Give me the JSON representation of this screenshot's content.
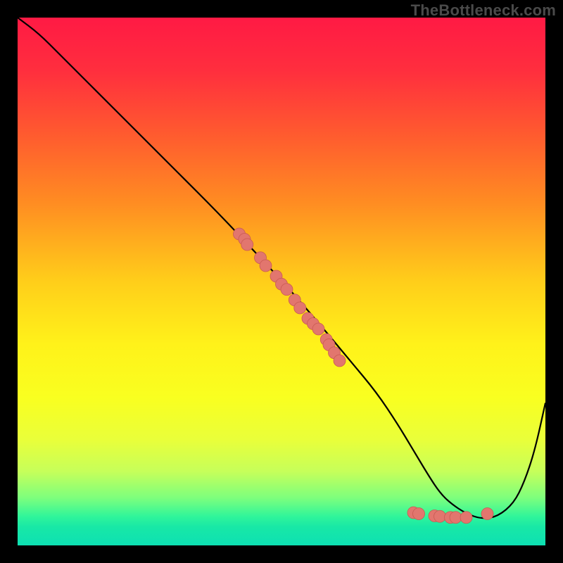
{
  "watermark": "TheBottleneck.com",
  "colors": {
    "background": "#000000",
    "curve_stroke": "#000000",
    "dot_fill": "#e2766e",
    "dot_stroke": "#c95a52",
    "gradient_stops": [
      {
        "offset": 0.0,
        "color": "#ff1a44"
      },
      {
        "offset": 0.1,
        "color": "#ff2e3e"
      },
      {
        "offset": 0.22,
        "color": "#ff5a2f"
      },
      {
        "offset": 0.35,
        "color": "#ff8c22"
      },
      {
        "offset": 0.5,
        "color": "#ffce1a"
      },
      {
        "offset": 0.62,
        "color": "#fff21a"
      },
      {
        "offset": 0.72,
        "color": "#f9ff20"
      },
      {
        "offset": 0.8,
        "color": "#e9ff3a"
      },
      {
        "offset": 0.86,
        "color": "#c6ff5a"
      },
      {
        "offset": 0.91,
        "color": "#7dff7d"
      },
      {
        "offset": 0.945,
        "color": "#30f59a"
      },
      {
        "offset": 0.965,
        "color": "#18e8a6"
      },
      {
        "offset": 1.0,
        "color": "#0de0b3"
      }
    ]
  },
  "chart_data": {
    "type": "line",
    "title": "",
    "xlabel": "",
    "ylabel": "",
    "xlim": [
      0,
      100
    ],
    "ylim": [
      0,
      100
    ],
    "legend": false,
    "grid": false,
    "series": [
      {
        "name": "bottleneck-curve",
        "x": [
          0,
          4,
          8,
          14,
          22,
          30,
          38,
          46,
          52,
          58,
          63,
          68,
          72,
          75,
          78,
          80,
          82,
          85,
          88,
          91,
          94,
          96,
          98,
          100
        ],
        "y": [
          100,
          97,
          93,
          87,
          79,
          71,
          63,
          54.5,
          48,
          41,
          35,
          29,
          23,
          18,
          13,
          10,
          8,
          6,
          5,
          5.5,
          8,
          12,
          18,
          27
        ]
      }
    ],
    "scatter": {
      "name": "highlighted-points",
      "points": [
        {
          "x": 42,
          "y": 59
        },
        {
          "x": 43,
          "y": 58
        },
        {
          "x": 43.5,
          "y": 57
        },
        {
          "x": 46,
          "y": 54.5
        },
        {
          "x": 47,
          "y": 53
        },
        {
          "x": 49,
          "y": 51
        },
        {
          "x": 50,
          "y": 49.5
        },
        {
          "x": 51,
          "y": 48.5
        },
        {
          "x": 52.5,
          "y": 46.5
        },
        {
          "x": 53.5,
          "y": 45
        },
        {
          "x": 55,
          "y": 43
        },
        {
          "x": 56,
          "y": 42
        },
        {
          "x": 57,
          "y": 41
        },
        {
          "x": 58.5,
          "y": 39
        },
        {
          "x": 59,
          "y": 38
        },
        {
          "x": 60,
          "y": 36.5
        },
        {
          "x": 61,
          "y": 35
        },
        {
          "x": 75,
          "y": 6.2
        },
        {
          "x": 76,
          "y": 6.0
        },
        {
          "x": 79,
          "y": 5.6
        },
        {
          "x": 80,
          "y": 5.5
        },
        {
          "x": 82,
          "y": 5.3
        },
        {
          "x": 83,
          "y": 5.3
        },
        {
          "x": 85,
          "y": 5.3
        },
        {
          "x": 89,
          "y": 6.0
        }
      ]
    }
  }
}
